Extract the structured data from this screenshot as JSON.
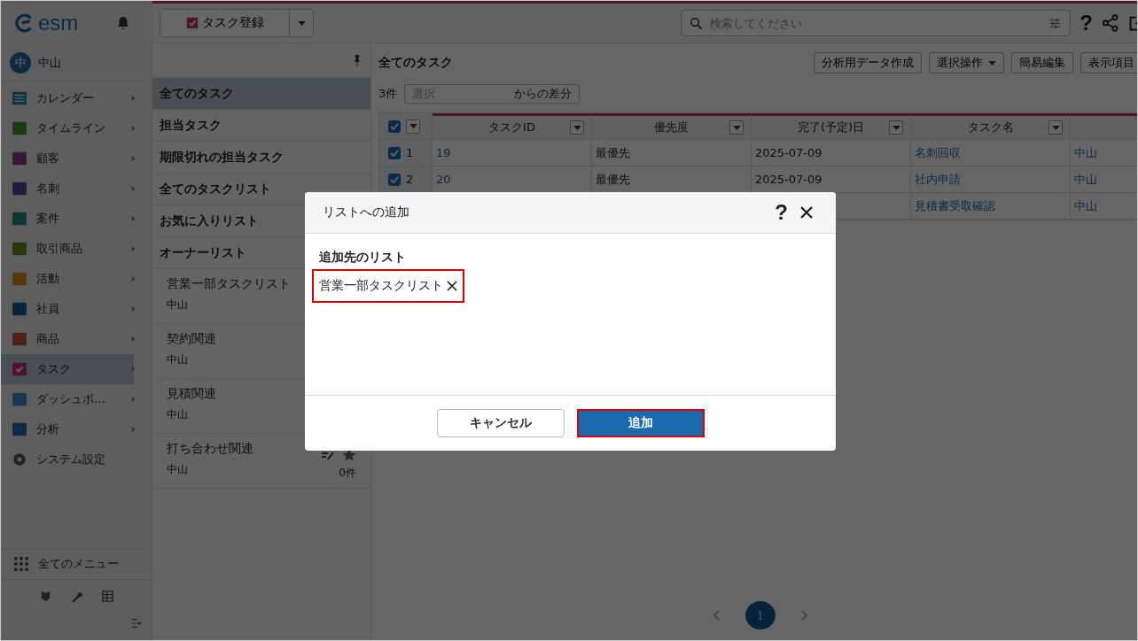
{
  "app": {
    "logo": "esm",
    "user": {
      "avatar": "中",
      "name": "中山"
    },
    "create_button": "タスク登録",
    "search": {
      "placeholder": "検索してください"
    },
    "help": "?"
  },
  "sidebar": {
    "items": [
      {
        "label": "カレンダー",
        "submenu": true,
        "selected": false
      },
      {
        "label": "タイムライン",
        "submenu": true,
        "selected": false
      },
      {
        "label": "顧客",
        "submenu": true,
        "selected": false
      },
      {
        "label": "名刺",
        "submenu": true,
        "selected": false
      },
      {
        "label": "案件",
        "submenu": true,
        "selected": false
      },
      {
        "label": "取引商品",
        "submenu": true,
        "selected": false
      },
      {
        "label": "活動",
        "submenu": true,
        "selected": false
      },
      {
        "label": "社員",
        "submenu": true,
        "selected": false
      },
      {
        "label": "商品",
        "submenu": true,
        "selected": false
      },
      {
        "label": "タスク",
        "submenu": true,
        "selected": true
      },
      {
        "label": "ダッシュボ…",
        "submenu": true,
        "selected": false
      },
      {
        "label": "分析",
        "submenu": true,
        "selected": false
      },
      {
        "label": "システム設定",
        "submenu": false,
        "selected": false
      }
    ],
    "all_menu": "全てのメニュー"
  },
  "list_panel": {
    "views": [
      {
        "label": "全てのタスク",
        "selected": true
      },
      {
        "label": "担当タスク",
        "selected": false
      },
      {
        "label": "期限切れの担当タスク",
        "selected": false
      },
      {
        "label": "全てのタスクリスト",
        "selected": false
      },
      {
        "label": "お気に入りリスト",
        "selected": false
      },
      {
        "label": "オーナーリスト",
        "selected": false
      }
    ],
    "lists": [
      {
        "name": "営業一部タスクリスト",
        "owner": "中山"
      },
      {
        "name": "契約関連",
        "owner": "中山"
      },
      {
        "name": "見積関連",
        "owner": "中山"
      },
      {
        "name": "打ち合わせ関連",
        "owner": "中山",
        "count": "0件"
      }
    ]
  },
  "main": {
    "title": "全てのタスク",
    "actions": [
      {
        "label": "分析用データ作成",
        "dropdown": false
      },
      {
        "label": "選択操作",
        "dropdown": true
      },
      {
        "label": "簡易編集",
        "dropdown": false
      },
      {
        "label": "表示項目",
        "dropdown": false
      }
    ],
    "count": "3件",
    "diff": {
      "placeholder": "選択",
      "suffix": "からの差分"
    },
    "table": {
      "all_checked": true,
      "columns": [
        "タスクID",
        "優先度",
        "完了(予定)日",
        "タスク名",
        ""
      ],
      "rows": [
        {
          "no": "1",
          "checked": true,
          "id": "19",
          "priority": "最優先",
          "date": "2025-07-09",
          "name": "名刺回収",
          "owner": "中山"
        },
        {
          "no": "2",
          "checked": true,
          "id": "20",
          "priority": "最優先",
          "date": "2025-07-09",
          "name": "社内申請",
          "owner": "中山"
        },
        {
          "name": "見積書受取確認",
          "owner": "中山"
        }
      ]
    },
    "pagination": {
      "pages": [
        {
          "label": "1",
          "selected": true
        }
      ]
    }
  },
  "dialog": {
    "title": "リストへの追加",
    "help": "?",
    "field_label": "追加先のリスト",
    "selected_list": "営業一部タスクリスト",
    "highlighted": true,
    "buttons": [
      {
        "label": "キャンセル",
        "primary": false,
        "highlighted": false
      },
      {
        "label": "追加",
        "primary": true,
        "highlighted": true
      }
    ]
  }
}
